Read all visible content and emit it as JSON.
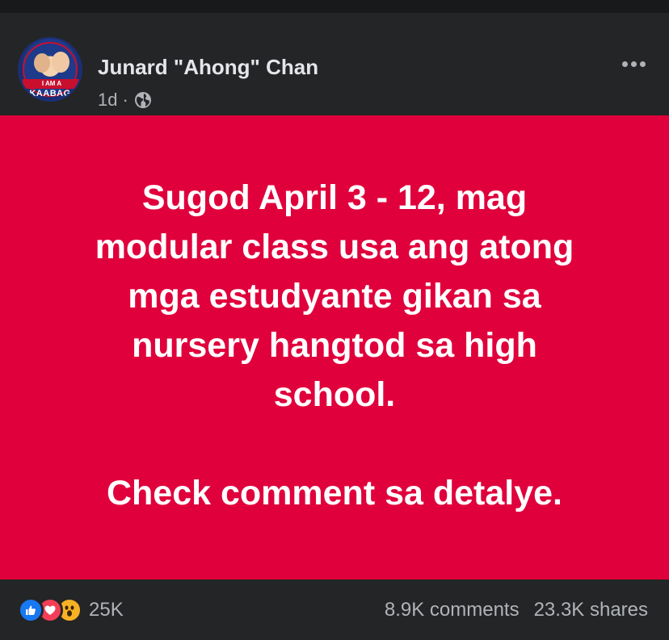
{
  "post": {
    "author": "Junard \"Ahong\" Chan",
    "time": "1d",
    "separator": "·",
    "audience_icon": "globe-icon",
    "avatar": {
      "banner_text": "I AM A",
      "brand_text": "KAABAG"
    },
    "more_icon": "more-options-icon",
    "background_color": "#e0003c",
    "text_lines": [
      "Sugod April 3 - 12, mag",
      "modular class usa ang atong",
      "mga estudyante gikan sa",
      "nursery hangtod sa high",
      "school."
    ],
    "closing_line": "Check comment sa detalye."
  },
  "footer": {
    "reaction_icons": [
      "like-icon",
      "love-icon",
      "wow-icon"
    ],
    "reaction_count": "25K",
    "comments": "8.9K comments",
    "shares": "23.3K shares"
  },
  "colors": {
    "surface": "#242526",
    "text_primary": "#e4e6eb",
    "text_secondary": "#b0b3b8",
    "like": "#1877f2",
    "love": "#f33e58",
    "wow": "#f7b125"
  }
}
